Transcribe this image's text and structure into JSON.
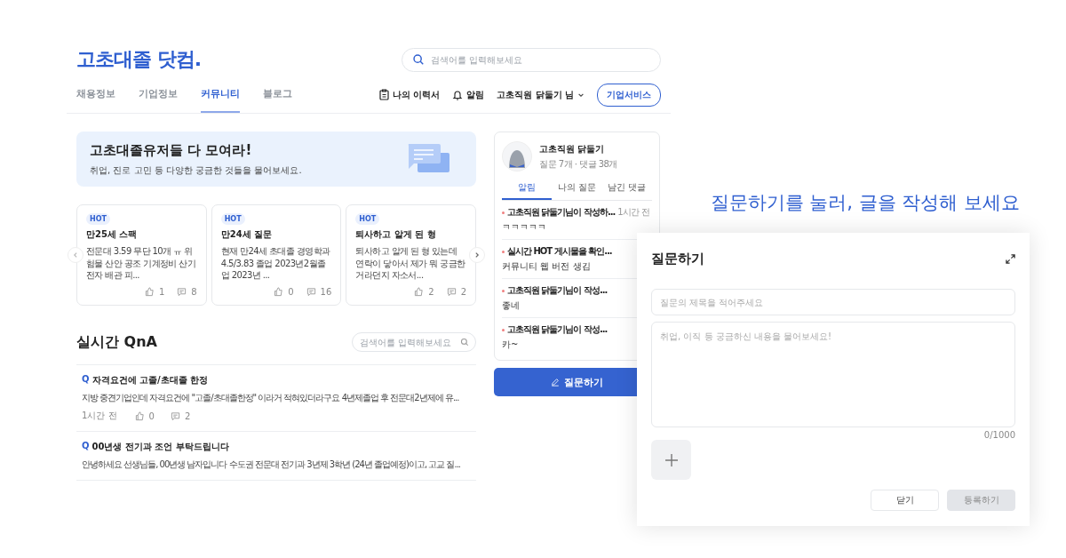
{
  "header": {
    "logo": "고초대졸 닷컴.",
    "search": {
      "placeholder": "검색어를 입력해보세요"
    },
    "nav": [
      {
        "label": "채용정보",
        "selected": false
      },
      {
        "label": "기업정보",
        "selected": false
      },
      {
        "label": "커뮤니티",
        "selected": true
      },
      {
        "label": "블로그",
        "selected": false
      }
    ],
    "resume": "나의 이력서",
    "alerts": "알림",
    "user": "고초직원 닭둘기 님",
    "service_button": "기업서비스"
  },
  "banner": {
    "title": "고초대졸유저들 다 모여라!",
    "subtitle": "취업, 진로 고민 등 다양한 궁금한 것들을 물어보세요."
  },
  "hot_posts": [
    {
      "badge": "HOT",
      "title": "만25세 스팩",
      "excerpt": "전문대 3.59 무단 10개 ㅠ 위험물 산안 공조 기계정비 산기 전자 배관 피...",
      "likes": "1",
      "comments": "8"
    },
    {
      "badge": "HOT",
      "title": "만24세 질문",
      "excerpt": "현재 만24세 초대졸 경영학과 4.5/3.83 졸업 2023년2월졸업 2023년 ...",
      "likes": "0",
      "comments": "16"
    },
    {
      "badge": "HOT",
      "title": "퇴사하고 알게 된 형",
      "excerpt": "퇴사하고 알게 된 형 있는데 연락이 닿아서 제가 뭐 궁금한거라던지 자소서...",
      "likes": "2",
      "comments": "2"
    }
  ],
  "qna": {
    "title": "실시간 QnA",
    "search": {
      "placeholder": "검색어를 입력해보세요"
    },
    "items": [
      {
        "mark": "Q",
        "title": "자격요건에 고졸/초대졸 한정",
        "excerpt": "지방 중견기업인데 자격요건에 \"고졸/초대졸한정\" 이라거 적혀있더라구요 4년제졸업 후 전문대2년제에 유...",
        "time": "1시간 전",
        "likes": "0",
        "comments": "2"
      },
      {
        "mark": "Q",
        "title": "00년생 전기과 조언 부탁드립니다",
        "excerpt": "안녕하세요 선생님들, 00년생 남자입니다 수도권 전문대 전기과 3년제 3학년 (24년 졸업예정)이고, 고교 질..."
      }
    ]
  },
  "profile": {
    "name": "고초직원 닭둘기",
    "stats": "질문 7개 · 댓글 38개",
    "tabs": [
      {
        "label": "알림",
        "selected": true
      },
      {
        "label": "나의 질문",
        "selected": false
      },
      {
        "label": "남긴 댓글",
        "selected": false
      }
    ],
    "notifications": [
      {
        "title": "고초직원 닭둘기님이 작성하...",
        "body": "ㅋㅋㅋㅋㅋ",
        "time": "1시간 전"
      },
      {
        "title": "실시간 HOT 게시물을 확인...",
        "body": "커뮤니티 웹 버전 생김"
      },
      {
        "title": "고초직원 닭둘기님이 작성...",
        "body": "좋네"
      },
      {
        "title": "고초직원 닭둘기님이 작성...",
        "body": "카~"
      }
    ]
  },
  "ask_button": "질문하기",
  "caption": "질문하기를 눌러, 글을 작성해 보세요",
  "modal": {
    "title": "질문하기",
    "title_field": {
      "placeholder": "질문의 제목을 적어주세요"
    },
    "body_field": {
      "placeholder": "취업, 이직 등 궁금하신 내용을 물어보세요!"
    },
    "counter": "0/1000",
    "close_button": "닫기",
    "submit_button": {
      "label": "등록하기",
      "disabled": true
    }
  }
}
